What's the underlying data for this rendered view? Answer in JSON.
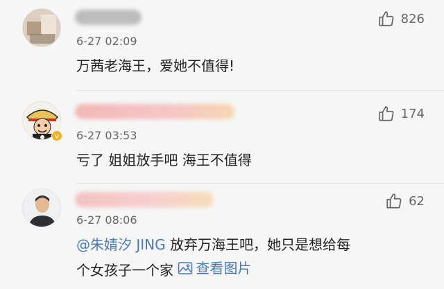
{
  "comments": [
    {
      "time": "6-27 02:09",
      "text": "万茜老海王，爱她不值得!",
      "likes": "826"
    },
    {
      "time": "6-27 03:53",
      "text": "亏了 姐姐放手吧 海王不值得",
      "likes": "174"
    },
    {
      "time": "6-27 08:06",
      "mention": "@朱婧汐 JING",
      "text_line1": " 放弃万海王吧，她只是想给每",
      "text_line2": "个女孩子一个家",
      "image_link": "查看图片",
      "likes": "62"
    }
  ],
  "icons": {
    "like": "thumbs-up-icon",
    "image": "image-icon",
    "verified": "verified-badge-icon"
  },
  "colors": {
    "link": "#4a7bb7",
    "verified": "#f3b01c"
  }
}
